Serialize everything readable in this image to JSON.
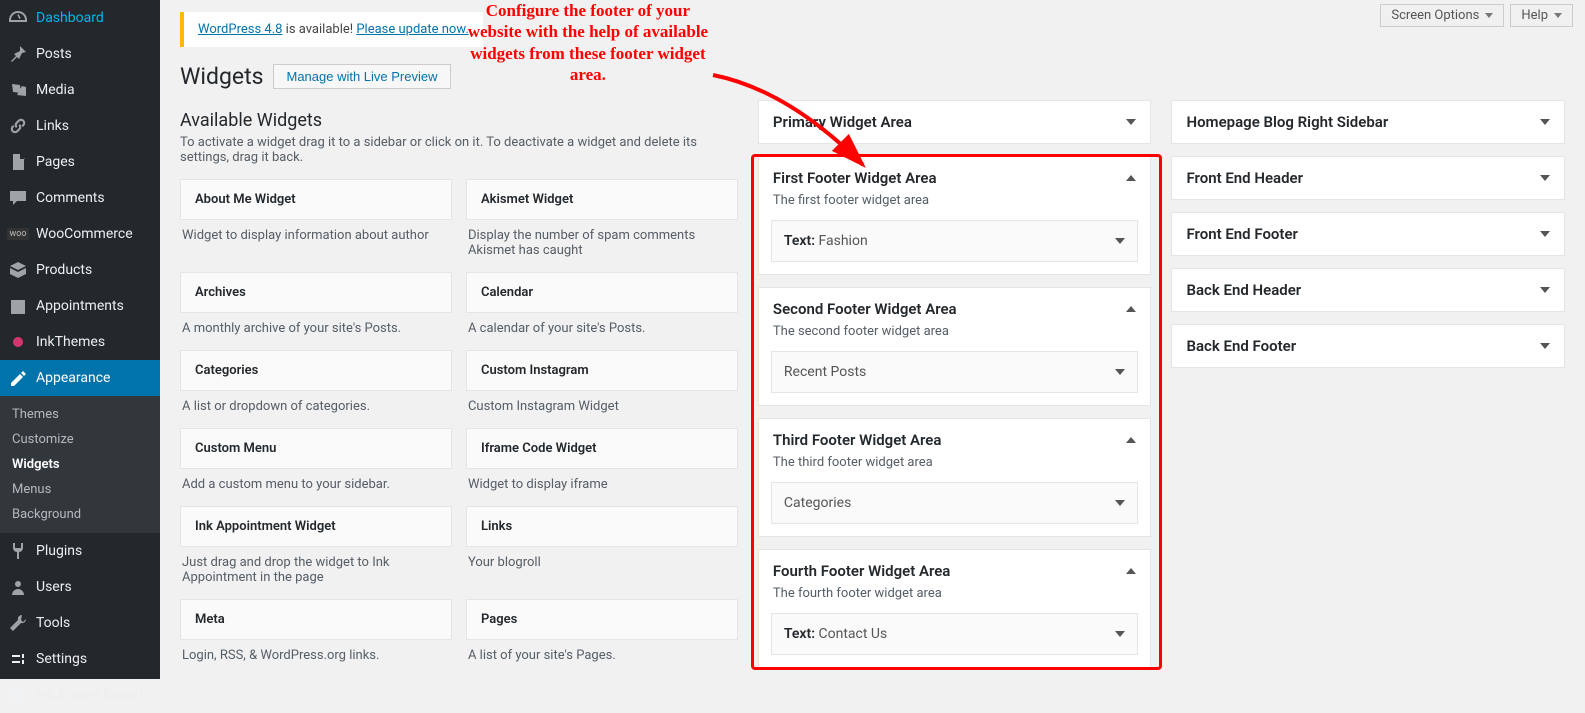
{
  "top_actions": {
    "screen_options": "Screen Options",
    "help": "Help"
  },
  "update_nag": {
    "prefix": "WordPress 4.8",
    "middle": " is available! ",
    "link": "Please update now."
  },
  "page": {
    "title": "Widgets",
    "preview_btn": "Manage with Live Preview"
  },
  "available": {
    "heading": "Available Widgets",
    "help": "To activate a widget drag it to a sidebar or click on it. To deactivate a widget and delete its settings, drag it back.",
    "items": [
      {
        "title": "About Me Widget",
        "desc": "Widget to display information about author"
      },
      {
        "title": "Akismet Widget",
        "desc": "Display the number of spam comments Akismet has caught"
      },
      {
        "title": "Archives",
        "desc": "A monthly archive of your site's Posts."
      },
      {
        "title": "Calendar",
        "desc": "A calendar of your site's Posts."
      },
      {
        "title": "Categories",
        "desc": "A list or dropdown of categories."
      },
      {
        "title": "Custom Instagram",
        "desc": "Custom Instagram Widget"
      },
      {
        "title": "Custom Menu",
        "desc": "Add a custom menu to your sidebar."
      },
      {
        "title": "Iframe Code Widget",
        "desc": "Widget to display iframe"
      },
      {
        "title": "Ink Appointment Widget",
        "desc": "Just drag and drop the widget to Ink Appointment in the page"
      },
      {
        "title": "Links",
        "desc": "Your blogroll"
      },
      {
        "title": "Meta",
        "desc": "Login, RSS, & WordPress.org links."
      },
      {
        "title": "Pages",
        "desc": "A list of your site's Pages."
      }
    ]
  },
  "widget_areas": {
    "primary": {
      "title": "Primary Widget Area"
    },
    "footers": [
      {
        "title": "First Footer Widget Area",
        "desc": "The first footer widget area",
        "widget_prefix": "Text:",
        "widget_value": " Fashion"
      },
      {
        "title": "Second Footer Widget Area",
        "desc": "The second footer widget area",
        "widget_prefix": "",
        "widget_value": "Recent Posts"
      },
      {
        "title": "Third Footer Widget Area",
        "desc": "The third footer widget area",
        "widget_prefix": "",
        "widget_value": "Categories"
      },
      {
        "title": "Fourth Footer Widget Area",
        "desc": "The fourth footer widget area",
        "widget_prefix": "Text:",
        "widget_value": " Contact Us"
      }
    ]
  },
  "right_areas": [
    "Homepage Blog Right Sidebar",
    "Front End Header",
    "Front End Footer",
    "Back End Header",
    "Back End Footer"
  ],
  "sidebar": {
    "items": [
      "Dashboard",
      "Posts",
      "Media",
      "Links",
      "Pages",
      "Comments",
      "WooCommerce",
      "Products",
      "Appointments",
      "InkThemes",
      "Appearance",
      "Plugins",
      "Users",
      "Tools",
      "Settings",
      "Ink Import Export"
    ],
    "appearance_submenu": [
      "Themes",
      "Customize",
      "Widgets",
      "Menus",
      "Background"
    ]
  },
  "annotation": "Configure the footer of your website with the help of available widgets from these footer widget area."
}
